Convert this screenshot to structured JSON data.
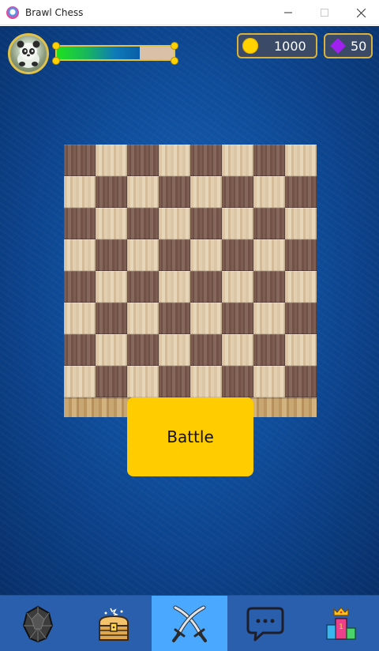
{
  "window": {
    "title": "Brawl Chess",
    "controls": [
      "minimize",
      "maximize",
      "close"
    ]
  },
  "hud": {
    "avatar_icon": "panda-avatar-icon",
    "xp_progress_fraction": 0.71,
    "coins": "1000",
    "gems": "50",
    "colors": {
      "coin": "#ffd200",
      "gem": "#a020f0",
      "frame": "#d9b13a"
    }
  },
  "board": {
    "size": 8,
    "dark_color": "#7d5d52",
    "light_color": "#dcc6a6",
    "top_left": "dark"
  },
  "battle_button": {
    "label": "Battle",
    "color": "#ffcc00"
  },
  "bottom_nav": {
    "active_index": 2,
    "items": [
      {
        "id": "gem",
        "icon": "gemstone-icon"
      },
      {
        "id": "chest",
        "icon": "treasure-chest-icon"
      },
      {
        "id": "battle",
        "icon": "crossed-swords-icon"
      },
      {
        "id": "chat",
        "icon": "chat-bubble-icon"
      },
      {
        "id": "rank",
        "icon": "podium-crown-icon"
      }
    ]
  }
}
